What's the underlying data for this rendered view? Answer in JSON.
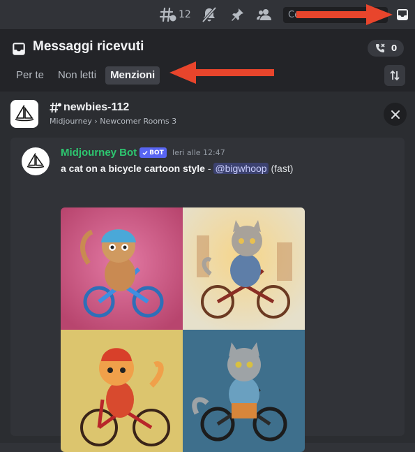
{
  "toolbar": {
    "thread_count": "12",
    "search_placeholder": "Ce",
    "icons": [
      "threads-icon",
      "notifications-muted-icon",
      "pin-icon",
      "members-icon",
      "inbox-icon"
    ]
  },
  "inbox": {
    "title": "Messaggi ricevuti",
    "mention_count": "0",
    "tabs": [
      {
        "label": "Per te",
        "active": false
      },
      {
        "label": "Non letti",
        "active": false
      },
      {
        "label": "Menzioni",
        "active": true
      }
    ]
  },
  "channel": {
    "name": "newbies-112",
    "path": "Midjourney › Newcomer Rooms 3"
  },
  "message": {
    "author": "Midjourney Bot",
    "bot_tag": "BOT",
    "timestamp": "Ieri alle 12:47",
    "prompt": "a cat on a bicycle cartoon style",
    "separator": " - ",
    "mention": "@bigwhoop",
    "suffix": " (fast)",
    "image_tiles": [
      "cat-bicycle-image-1",
      "cat-bicycle-image-2",
      "cat-bicycle-image-3",
      "cat-bicycle-image-4"
    ]
  },
  "colors": {
    "author_green": "#2dc770",
    "bot_blurple": "#5865f2",
    "annotation_red": "#e8452c",
    "tile_1": "#c9527e",
    "tile_2": "#e8dcc0",
    "tile_3": "#e0c870",
    "tile_4": "#3e6f8c"
  }
}
